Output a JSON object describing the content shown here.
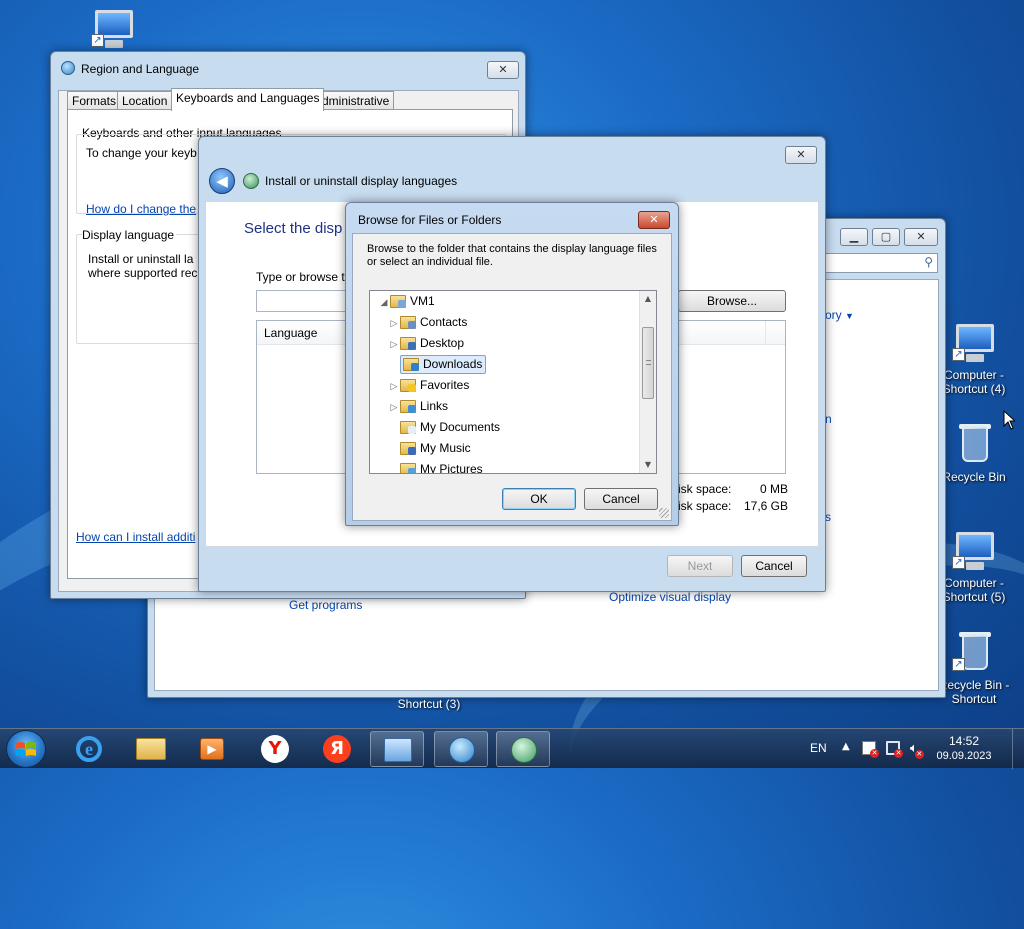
{
  "desktop": {
    "icons": [
      {
        "label_line1": "Computer -",
        "label_line2": "Shortcut (4)"
      },
      {
        "label_line1": "Recycle Bin",
        "label_line2": ""
      },
      {
        "label_line1": "Computer -",
        "label_line2": "Shortcut (5)"
      },
      {
        "label_line1": "Recycle Bin -",
        "label_line2": "Shortcut"
      },
      {
        "label_line1": "Shortcut (3)",
        "label_line2": ""
      }
    ]
  },
  "region_window": {
    "title": "Region and Language",
    "tabs": [
      "Formats",
      "Location",
      "Keyboards and Languages",
      "Administrative"
    ],
    "keyboards_group": "Keyboards and other input languages",
    "keyboards_text": "To change your keyb",
    "keyboards_link": "How do I change the",
    "display_group": "Display language",
    "display_text_1": "Install or uninstall la",
    "display_text_2": "where supported rec",
    "bottom_link": "How can I install additi"
  },
  "background_window": {
    "history_link": "ory",
    "link_n": "n",
    "link_s": "s",
    "get_programs": "Get programs",
    "optimize_display": "Optimize visual display"
  },
  "install_window": {
    "header": "Install or uninstall display languages",
    "heading": "Select the disp",
    "type_label": "Type or browse t",
    "browse_button": "Browse...",
    "column_language": "Language",
    "disk_label_1": "isk space:",
    "disk_value_1": "0 MB",
    "disk_label_2": "isk space:",
    "disk_value_2": "17,6 GB",
    "next_button": "Next",
    "cancel_button": "Cancel"
  },
  "browse_dialog": {
    "title": "Browse for Files or Folders",
    "close_glyph": "✕",
    "description": "Browse to the folder that contains the display language files or select an individual file.",
    "tree": [
      {
        "label": "VM1",
        "expander": "◢"
      },
      {
        "label": "Contacts",
        "expander": "▷"
      },
      {
        "label": "Desktop",
        "expander": "▷"
      },
      {
        "label": "Downloads",
        "expander": ""
      },
      {
        "label": "Favorites",
        "expander": "▷"
      },
      {
        "label": "Links",
        "expander": "▷"
      },
      {
        "label": "My Documents",
        "expander": ""
      },
      {
        "label": "My Music",
        "expander": ""
      },
      {
        "label": "My Pictures",
        "expander": ""
      }
    ],
    "selected": "Downloads",
    "ok_button": "OK",
    "cancel_button": "Cancel"
  },
  "taskbar": {
    "language": "EN",
    "time": "14:52",
    "date": "09.09.2023",
    "yandex_browser_glyph": "Y",
    "yandex_glyph": "Я"
  }
}
